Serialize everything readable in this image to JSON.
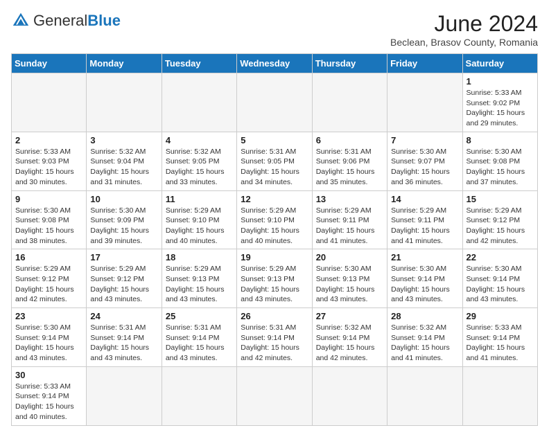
{
  "header": {
    "logo_general": "General",
    "logo_blue": "Blue",
    "month_title": "June 2024",
    "subtitle": "Beclean, Brasov County, Romania"
  },
  "weekdays": [
    "Sunday",
    "Monday",
    "Tuesday",
    "Wednesday",
    "Thursday",
    "Friday",
    "Saturday"
  ],
  "weeks": [
    [
      {
        "day": "",
        "info": ""
      },
      {
        "day": "",
        "info": ""
      },
      {
        "day": "",
        "info": ""
      },
      {
        "day": "",
        "info": ""
      },
      {
        "day": "",
        "info": ""
      },
      {
        "day": "",
        "info": ""
      },
      {
        "day": "1",
        "info": "Sunrise: 5:33 AM\nSunset: 9:02 PM\nDaylight: 15 hours\nand 29 minutes."
      }
    ],
    [
      {
        "day": "2",
        "info": "Sunrise: 5:33 AM\nSunset: 9:03 PM\nDaylight: 15 hours\nand 30 minutes."
      },
      {
        "day": "3",
        "info": "Sunrise: 5:32 AM\nSunset: 9:04 PM\nDaylight: 15 hours\nand 31 minutes."
      },
      {
        "day": "4",
        "info": "Sunrise: 5:32 AM\nSunset: 9:05 PM\nDaylight: 15 hours\nand 33 minutes."
      },
      {
        "day": "5",
        "info": "Sunrise: 5:31 AM\nSunset: 9:05 PM\nDaylight: 15 hours\nand 34 minutes."
      },
      {
        "day": "6",
        "info": "Sunrise: 5:31 AM\nSunset: 9:06 PM\nDaylight: 15 hours\nand 35 minutes."
      },
      {
        "day": "7",
        "info": "Sunrise: 5:30 AM\nSunset: 9:07 PM\nDaylight: 15 hours\nand 36 minutes."
      },
      {
        "day": "8",
        "info": "Sunrise: 5:30 AM\nSunset: 9:08 PM\nDaylight: 15 hours\nand 37 minutes."
      }
    ],
    [
      {
        "day": "9",
        "info": "Sunrise: 5:30 AM\nSunset: 9:08 PM\nDaylight: 15 hours\nand 38 minutes."
      },
      {
        "day": "10",
        "info": "Sunrise: 5:30 AM\nSunset: 9:09 PM\nDaylight: 15 hours\nand 39 minutes."
      },
      {
        "day": "11",
        "info": "Sunrise: 5:29 AM\nSunset: 9:10 PM\nDaylight: 15 hours\nand 40 minutes."
      },
      {
        "day": "12",
        "info": "Sunrise: 5:29 AM\nSunset: 9:10 PM\nDaylight: 15 hours\nand 40 minutes."
      },
      {
        "day": "13",
        "info": "Sunrise: 5:29 AM\nSunset: 9:11 PM\nDaylight: 15 hours\nand 41 minutes."
      },
      {
        "day": "14",
        "info": "Sunrise: 5:29 AM\nSunset: 9:11 PM\nDaylight: 15 hours\nand 41 minutes."
      },
      {
        "day": "15",
        "info": "Sunrise: 5:29 AM\nSunset: 9:12 PM\nDaylight: 15 hours\nand 42 minutes."
      }
    ],
    [
      {
        "day": "16",
        "info": "Sunrise: 5:29 AM\nSunset: 9:12 PM\nDaylight: 15 hours\nand 42 minutes."
      },
      {
        "day": "17",
        "info": "Sunrise: 5:29 AM\nSunset: 9:12 PM\nDaylight: 15 hours\nand 43 minutes."
      },
      {
        "day": "18",
        "info": "Sunrise: 5:29 AM\nSunset: 9:13 PM\nDaylight: 15 hours\nand 43 minutes."
      },
      {
        "day": "19",
        "info": "Sunrise: 5:29 AM\nSunset: 9:13 PM\nDaylight: 15 hours\nand 43 minutes."
      },
      {
        "day": "20",
        "info": "Sunrise: 5:30 AM\nSunset: 9:13 PM\nDaylight: 15 hours\nand 43 minutes."
      },
      {
        "day": "21",
        "info": "Sunrise: 5:30 AM\nSunset: 9:14 PM\nDaylight: 15 hours\nand 43 minutes."
      },
      {
        "day": "22",
        "info": "Sunrise: 5:30 AM\nSunset: 9:14 PM\nDaylight: 15 hours\nand 43 minutes."
      }
    ],
    [
      {
        "day": "23",
        "info": "Sunrise: 5:30 AM\nSunset: 9:14 PM\nDaylight: 15 hours\nand 43 minutes."
      },
      {
        "day": "24",
        "info": "Sunrise: 5:31 AM\nSunset: 9:14 PM\nDaylight: 15 hours\nand 43 minutes."
      },
      {
        "day": "25",
        "info": "Sunrise: 5:31 AM\nSunset: 9:14 PM\nDaylight: 15 hours\nand 43 minutes."
      },
      {
        "day": "26",
        "info": "Sunrise: 5:31 AM\nSunset: 9:14 PM\nDaylight: 15 hours\nand 42 minutes."
      },
      {
        "day": "27",
        "info": "Sunrise: 5:32 AM\nSunset: 9:14 PM\nDaylight: 15 hours\nand 42 minutes."
      },
      {
        "day": "28",
        "info": "Sunrise: 5:32 AM\nSunset: 9:14 PM\nDaylight: 15 hours\nand 41 minutes."
      },
      {
        "day": "29",
        "info": "Sunrise: 5:33 AM\nSunset: 9:14 PM\nDaylight: 15 hours\nand 41 minutes."
      }
    ],
    [
      {
        "day": "30",
        "info": "Sunrise: 5:33 AM\nSunset: 9:14 PM\nDaylight: 15 hours\nand 40 minutes."
      },
      {
        "day": "",
        "info": ""
      },
      {
        "day": "",
        "info": ""
      },
      {
        "day": "",
        "info": ""
      },
      {
        "day": "",
        "info": ""
      },
      {
        "day": "",
        "info": ""
      },
      {
        "day": "",
        "info": ""
      }
    ]
  ]
}
